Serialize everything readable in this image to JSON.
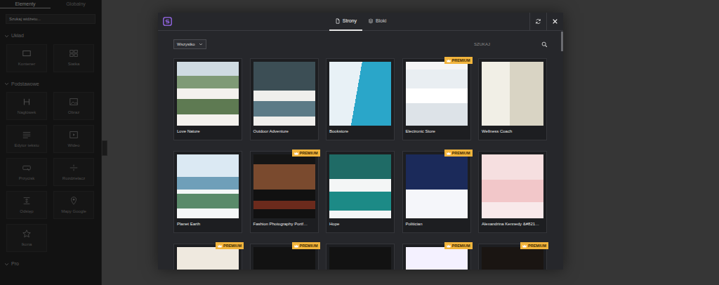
{
  "sidebar": {
    "tabs": [
      {
        "label": "Elementy",
        "selected": true
      },
      {
        "label": "Globalny",
        "selected": false
      }
    ],
    "search": {
      "placeholder": "Szukaj widżetu..."
    },
    "sections": [
      {
        "title": "Układ",
        "expanded": true,
        "items": [
          "Kontener",
          "Siatka"
        ]
      },
      {
        "title": "Podstawowe",
        "expanded": true,
        "items": [
          "Nagłówek",
          "Obraz",
          "Edytor tekstu",
          "Wideo",
          "Przycisk",
          "Rozdzielacz",
          "Odstęp",
          "Mapy Google",
          "Ikona"
        ]
      },
      {
        "title": "Pro",
        "expanded": true,
        "items": []
      }
    ]
  },
  "modal": {
    "tabs": [
      {
        "label": "Strony",
        "selected": true
      },
      {
        "label": "Bloki",
        "selected": false
      }
    ],
    "filter": {
      "value": "Wszystko"
    },
    "search": {
      "placeholder": "SZUKAJ"
    },
    "premium_label": "PREMIUM",
    "templates": [
      {
        "title": "Love Nature",
        "premium": false
      },
      {
        "title": "Outdoor Adventure",
        "premium": false
      },
      {
        "title": "Bookstore",
        "premium": false
      },
      {
        "title": "Electronic Store",
        "premium": true
      },
      {
        "title": "Wellness Coach",
        "premium": false
      },
      {
        "title": "Planet Earth",
        "premium": false
      },
      {
        "title": "Fashion Photography Portf…",
        "premium": true
      },
      {
        "title": "Hope",
        "premium": false
      },
      {
        "title": "Politician",
        "premium": true
      },
      {
        "title": "Alexandrina Kennedy &#821…",
        "premium": false
      },
      {
        "premium": true
      },
      {
        "premium": true
      },
      {
        "premium": false
      },
      {
        "premium": true
      },
      {
        "premium": true
      }
    ]
  }
}
